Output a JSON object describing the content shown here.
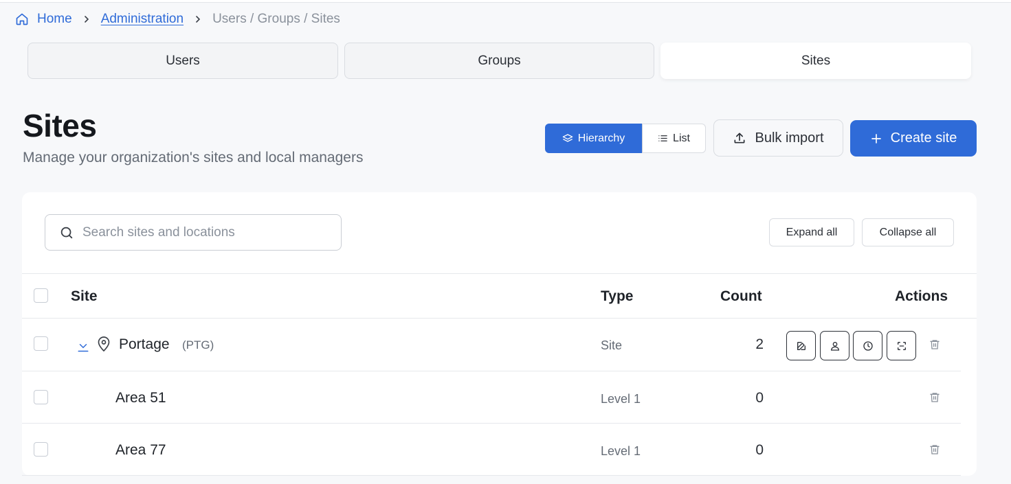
{
  "breadcrumb": {
    "home": "Home",
    "admin": "Administration",
    "current": "Users / Groups / Sites"
  },
  "tabs": [
    {
      "label": "Users",
      "active": false
    },
    {
      "label": "Groups",
      "active": false
    },
    {
      "label": "Sites",
      "active": true
    }
  ],
  "header": {
    "title": "Sites",
    "subtitle": "Manage your organization's sites and local managers"
  },
  "toolbar": {
    "hierarchy_label": "Hierarchy",
    "list_label": "List",
    "bulk_import_label": "Bulk import",
    "create_label": "Create site"
  },
  "search": {
    "placeholder": "Search sites and locations",
    "value": ""
  },
  "tree_controls": {
    "expand_label": "Expand all",
    "collapse_label": "Collapse all"
  },
  "table": {
    "columns": [
      "Site",
      "Type",
      "Count",
      "Actions"
    ],
    "rows": [
      {
        "name": "Portage",
        "code": "(PTG)",
        "type": "Site",
        "count": "2"
      },
      {
        "name": "Area 51",
        "code": "",
        "type": "Level 1",
        "count": "0"
      },
      {
        "name": "Area 77",
        "code": "",
        "type": "Level 1",
        "count": "0"
      }
    ]
  },
  "colors": {
    "accent": "#2f6bd8",
    "background": "#f7f8fa",
    "muted_text": "#646b75"
  },
  "icons": [
    "home-icon",
    "chevron-right-icon",
    "layers-icon",
    "list-icon",
    "upload-icon",
    "plus-icon",
    "search-icon",
    "chevron-down-icon",
    "map-pin-icon",
    "edit-icon",
    "user-icon",
    "clock-icon",
    "scan-icon",
    "trash-icon"
  ]
}
